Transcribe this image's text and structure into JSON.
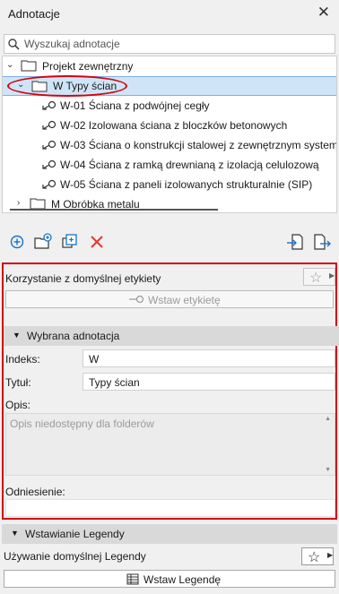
{
  "window": {
    "title": "Adnotacje"
  },
  "search": {
    "placeholder": "Wyszukaj adnotacje"
  },
  "tree": {
    "root": "Projekt zewnętrzny",
    "selected_folder": "W Typy ścian",
    "items": [
      "W-01 Ściana z podwójnej cegły",
      "W-02 Izolowana ściana z bloczków betonowych",
      "W-03 Ściana o konstrukcji stalowej z zewnętrznym system",
      "W-04 Ściana z ramką drewnianą z izolacją celulozową",
      "W-05 Ściana z paneli izolowanych strukturalnie (SIP)"
    ],
    "other_folder": "M Obróbka metalu"
  },
  "label_section": {
    "caption": "Korzystanie z domyślnej etykiety",
    "insert_label_button": "Wstaw etykietę"
  },
  "selected_annotation": {
    "header": "Wybrana adnotacja",
    "index_label": "Indeks:",
    "index_value": "W",
    "title_label": "Tytuł:",
    "title_value": "Typy ścian",
    "desc_label": "Opis:",
    "desc_placeholder": "Opis niedostępny dla folderów",
    "reference_label": "Odniesienie:"
  },
  "legend": {
    "header": "Wstawianie Legendy",
    "caption": "Używanie domyślnej Legendy",
    "insert_button": "Wstaw Legendę"
  },
  "colors": {
    "accent": "#1a73c7",
    "highlight_border": "#d4000f",
    "selection": "#cfe5f7",
    "delete": "#e03a2e"
  }
}
